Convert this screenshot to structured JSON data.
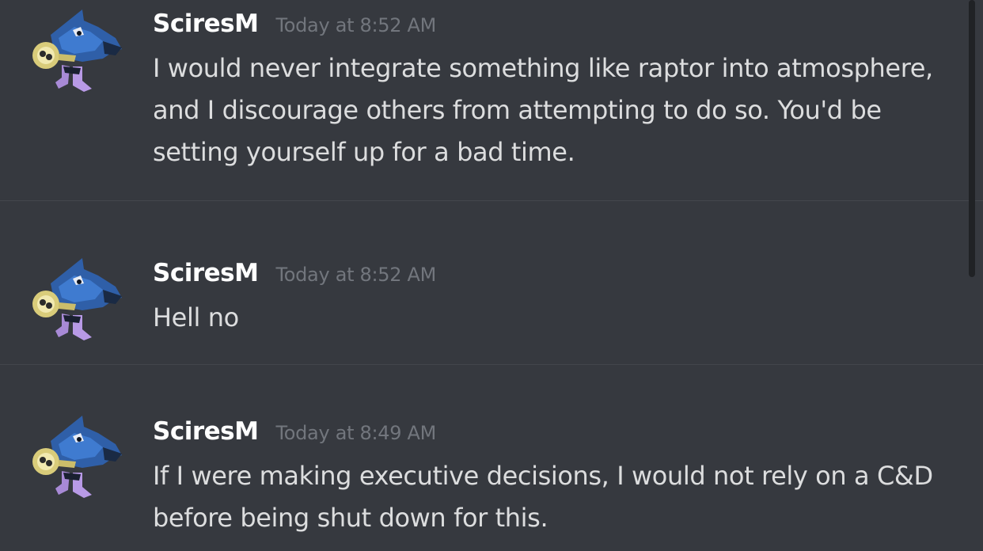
{
  "messages": [
    {
      "author": "SciresM",
      "timestamp": "Today at 8:52 AM",
      "content": "I would never integrate something like raptor into atmosphere, and I discourage others from attempting to do so. You'd be setting yourself up for a bad time."
    },
    {
      "author": "SciresM",
      "timestamp": "Today at 8:52 AM",
      "content": "Hell no"
    },
    {
      "author": "SciresM",
      "timestamp": "Today at 8:49 AM",
      "content": "If I were making executive decisions, I would not rely on a C&D before being shut down for this."
    }
  ],
  "colors": {
    "background": "#36393f",
    "author": "#ffffff",
    "timestamp": "#72767d",
    "message_text": "#dcddde",
    "divider": "#43464c"
  }
}
